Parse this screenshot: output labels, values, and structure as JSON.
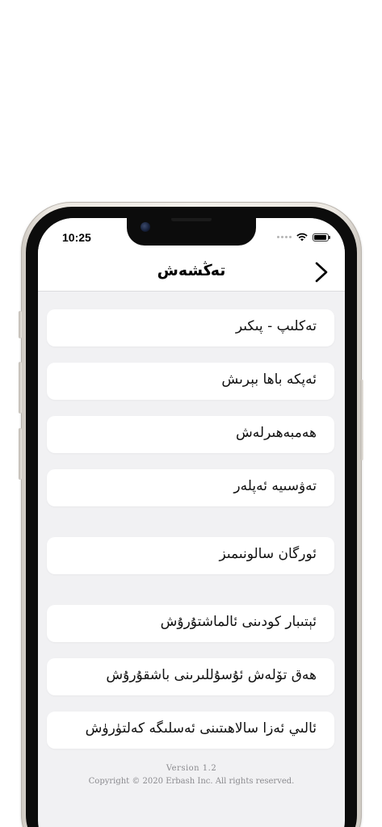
{
  "status_bar": {
    "time": "10:25"
  },
  "nav": {
    "title": "تەڭشەش",
    "back_icon": "chevron-right-icon"
  },
  "menu": {
    "items": [
      {
        "label": "تەكلىپ - پىكىر"
      },
      {
        "label": "ئەپكە باھا بېرىش"
      },
      {
        "label": "ھەمبەھىرلەش"
      },
      {
        "label": "تەۋسىيە ئەپلەر"
      },
      {
        "label": "ئورگان سالونىمىز"
      },
      {
        "label": "ئېتىبار كودىنى ئالماشتۇرۇش"
      },
      {
        "label": "ھەق تۆلەش ئۇسۇللىرىنى باشقۇرۇش"
      },
      {
        "label": "ئالىي ئەزا سالاھىتىنى ئەسلىگە كەلتۈرۈش"
      }
    ]
  },
  "footer": {
    "version": "Version 1.2",
    "copyright": "Copyright © 2020 Erbash Inc. All rights reserved."
  },
  "colors": {
    "background": "#f1f1f3",
    "card": "#ffffff",
    "text": "#111111",
    "footer_text": "#8a8a8e"
  }
}
